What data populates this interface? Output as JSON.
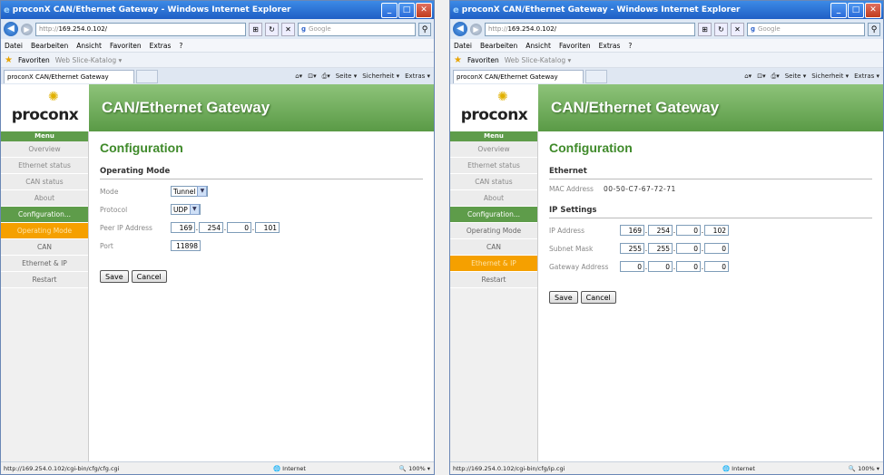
{
  "browser": {
    "title": "proconX CAN/Ethernet Gateway - Windows Internet Explorer",
    "url_prefix": "http://",
    "url_host": "169.254.0.102/",
    "search_placeholder": "Google",
    "menu": [
      "Datei",
      "Bearbeiten",
      "Ansicht",
      "Favoriten",
      "Extras",
      "?"
    ],
    "favorites_label": "Favoriten",
    "slice_label": "Web Slice-Katalog ▾",
    "tab_label": "proconX CAN/Ethernet Gateway",
    "cmd": [
      "Seite ▾",
      "Sicherheit ▾",
      "Extras ▾"
    ],
    "zone": "Internet",
    "zoom": "100%"
  },
  "page": {
    "logo": "proconx",
    "banner": "CAN/Ethernet Gateway",
    "menu_head": "Menu",
    "menu_items": [
      "Overview",
      "Ethernet status",
      "CAN status",
      "About",
      "Configuration...",
      "Operating Mode",
      "CAN",
      "Ethernet & IP",
      "Restart"
    ],
    "title": "Configuration",
    "save_label": "Save",
    "cancel_label": "Cancel"
  },
  "window1": {
    "status_url": "http://169.254.0.102/cgi-bin/cfg/cfg.cgi",
    "section": "Operating Mode",
    "mode_label": "Mode",
    "mode_value": "Tunnel",
    "protocol_label": "Protocol",
    "protocol_value": "UDP",
    "peer_label": "Peer IP Address",
    "peer_ip": [
      "169",
      "254",
      "0",
      "101"
    ],
    "port_label": "Port",
    "port_value": "11898"
  },
  "window2": {
    "status_url": "http://169.254.0.102/cgi-bin/cfg/ip.cgi",
    "section_eth": "Ethernet",
    "mac_label": "MAC Address",
    "mac_value": "00-50-C7-67-72-71",
    "section_ip": "IP Settings",
    "ip_label": "IP Address",
    "ip": [
      "169",
      "254",
      "0",
      "102"
    ],
    "mask_label": "Subnet Mask",
    "mask": [
      "255",
      "255",
      "0",
      "0"
    ],
    "gw_label": "Gateway Address",
    "gw": [
      "0",
      "0",
      "0",
      "0"
    ]
  },
  "colors": {
    "green": "#5e9c4a",
    "orange": "#f5a000",
    "title": "#3f8a2a"
  }
}
